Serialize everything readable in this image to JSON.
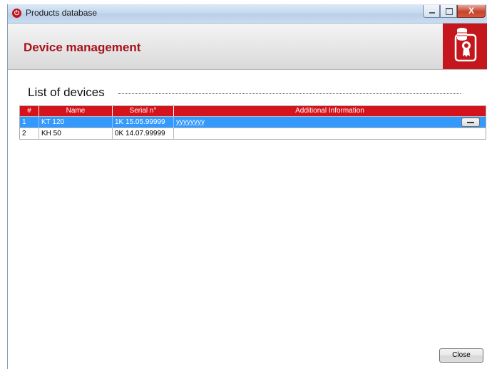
{
  "window": {
    "title": "Products database",
    "app_icon": "app-logo-icon",
    "close_glyph": "X"
  },
  "header": {
    "title": "Device management",
    "logo_icon": "database-certificate-icon",
    "accent_color": "#c4161c"
  },
  "section": {
    "title": "List of devices"
  },
  "table": {
    "columns": [
      "#",
      "Name",
      "Serial n°",
      "Additional Information"
    ],
    "rows": [
      {
        "num": "1",
        "name": "KT 120",
        "serial": "1K 15.05.99999",
        "info": "yyyyyyyy",
        "selected": true
      },
      {
        "num": "2",
        "name": "KH 50",
        "serial": "0K 14.07.99999",
        "info": "",
        "selected": false
      }
    ],
    "header_color": "#d4141c",
    "selection_color": "#3399ff"
  },
  "footer": {
    "close_label": "Close"
  }
}
